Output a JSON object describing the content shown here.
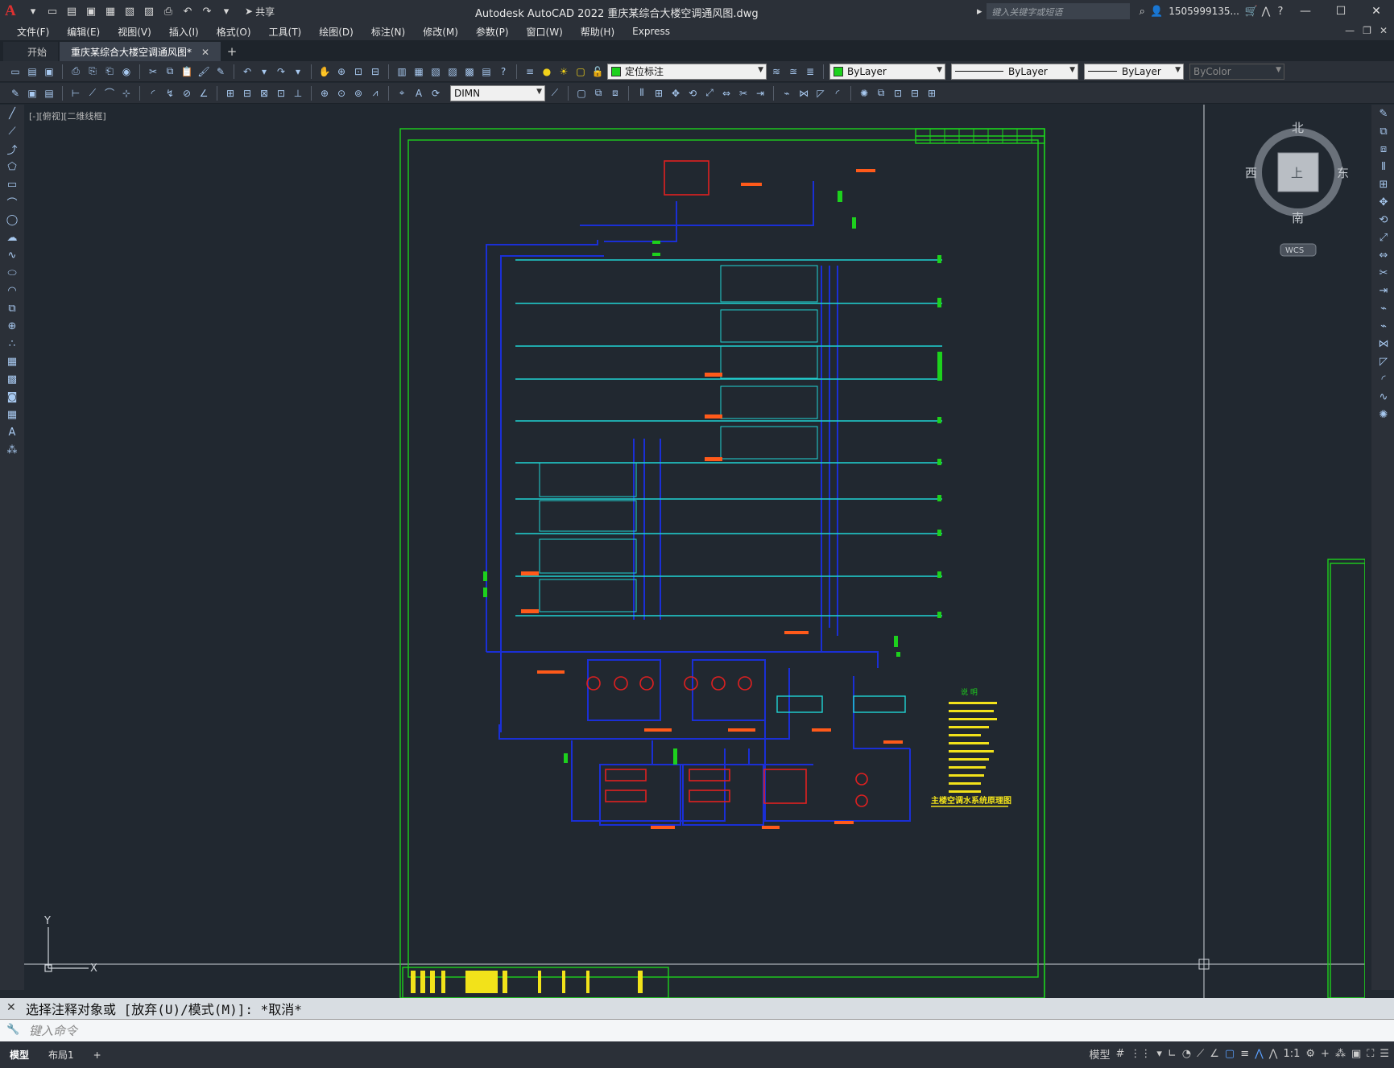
{
  "title": "Autodesk AutoCAD 2022    重庆某综合大楼空调通风图.dwg",
  "share_label": "共享",
  "search_placeholder": "键入关键字或短语",
  "user_label": "1505999135...",
  "menu": [
    "文件(F)",
    "编辑(E)",
    "视图(V)",
    "插入(I)",
    "格式(O)",
    "工具(T)",
    "绘图(D)",
    "标注(N)",
    "修改(M)",
    "参数(P)",
    "窗口(W)",
    "帮助(H)",
    "Express"
  ],
  "tabs": [
    {
      "label": "开始",
      "active": false
    },
    {
      "label": "重庆某综合大楼空调通风图*",
      "active": true
    }
  ],
  "toolbar": {
    "layer": "定位标注",
    "color": "ByLayer",
    "linetype": "ByLayer",
    "lineweight": "ByLayer",
    "plotstyle": "ByColor",
    "dimstyle": "DIMN"
  },
  "viewport_label": "[-][俯视][二维线框]",
  "viewcube": {
    "north": "北",
    "south": "南",
    "east": "东",
    "west": "西",
    "face": "上",
    "ucs": "WCS"
  },
  "ucs_axis": {
    "x": "X",
    "y": "Y"
  },
  "drawing": {
    "title": "主楼空调水系统原理图",
    "legend_title": "说 明"
  },
  "command": {
    "history": "选择注释对象或 [放弃(U)/模式(M)]: *取消*",
    "placeholder": "键入命令"
  },
  "status": {
    "layout_tabs": [
      "模型",
      "布局1"
    ],
    "model": "模型",
    "scale": "1:1"
  },
  "colors": {
    "background": "#212830",
    "frame": "#1dd11d",
    "pipe_blue": "#1a2fd6",
    "pipe_cyan": "#21d4d4",
    "equipment_red": "#e02020",
    "label_orange": "#ff5a1a",
    "note_yellow": "#f2e21a"
  }
}
